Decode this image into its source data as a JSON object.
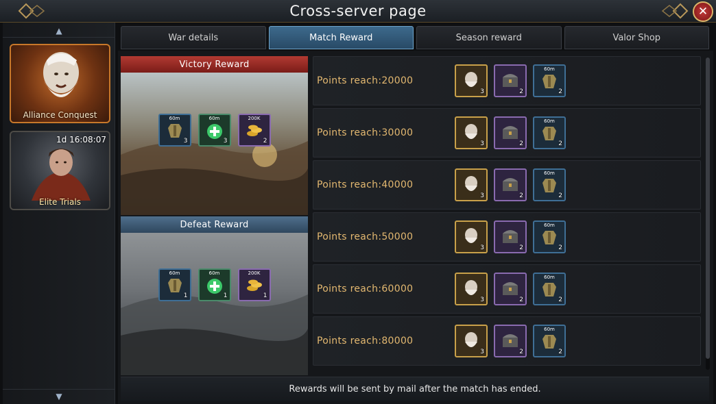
{
  "window": {
    "title": "Cross-server page"
  },
  "sidebar": {
    "items": [
      {
        "label": "Alliance Conquest",
        "timer": ""
      },
      {
        "label": "Elite Trials",
        "timer": "1d 16:08:07"
      }
    ]
  },
  "tabs": [
    {
      "label": "War details"
    },
    {
      "label": "Match Reward"
    },
    {
      "label": "Season reward"
    },
    {
      "label": "Valor Shop"
    }
  ],
  "victory": {
    "header": "Victory Reward",
    "items": [
      {
        "tag": "60m",
        "count": "3",
        "icon": "armor-icon"
      },
      {
        "tag": "60m",
        "count": "3",
        "icon": "heal-potion-icon"
      },
      {
        "tag": "200K",
        "count": "2",
        "icon": "gold-coins-icon"
      }
    ]
  },
  "defeat": {
    "header": "Defeat Reward",
    "items": [
      {
        "tag": "60m",
        "count": "1",
        "icon": "armor-icon"
      },
      {
        "tag": "60m",
        "count": "1",
        "icon": "heal-potion-icon"
      },
      {
        "tag": "200K",
        "count": "1",
        "icon": "gold-coins-icon"
      }
    ]
  },
  "points_rows": [
    {
      "label": "Points reach:20000",
      "items": [
        {
          "count": "3",
          "icon": "general-portrait-icon"
        },
        {
          "count": "2",
          "icon": "treasure-chest-icon"
        },
        {
          "tag": "60m",
          "count": "2",
          "icon": "armor-icon"
        }
      ]
    },
    {
      "label": "Points reach:30000",
      "items": [
        {
          "count": "3",
          "icon": "general-portrait-icon"
        },
        {
          "count": "2",
          "icon": "treasure-chest-icon"
        },
        {
          "tag": "60m",
          "count": "2",
          "icon": "armor-icon"
        }
      ]
    },
    {
      "label": "Points reach:40000",
      "items": [
        {
          "count": "3",
          "icon": "general-portrait-icon"
        },
        {
          "count": "2",
          "icon": "treasure-chest-icon"
        },
        {
          "tag": "60m",
          "count": "2",
          "icon": "armor-icon"
        }
      ]
    },
    {
      "label": "Points reach:50000",
      "items": [
        {
          "count": "3",
          "icon": "general-portrait-icon"
        },
        {
          "count": "2",
          "icon": "treasure-chest-icon"
        },
        {
          "tag": "60m",
          "count": "2",
          "icon": "armor-icon"
        }
      ]
    },
    {
      "label": "Points reach:60000",
      "items": [
        {
          "count": "3",
          "icon": "general-portrait-icon"
        },
        {
          "count": "2",
          "icon": "treasure-chest-icon"
        },
        {
          "tag": "60m",
          "count": "2",
          "icon": "armor-icon"
        }
      ]
    },
    {
      "label": "Points reach:80000",
      "items": [
        {
          "count": "3",
          "icon": "general-portrait-icon"
        },
        {
          "count": "2",
          "icon": "treasure-chest-icon"
        },
        {
          "tag": "60m",
          "count": "2",
          "icon": "armor-icon"
        }
      ]
    }
  ],
  "footer": {
    "note": "Rewards will be sent by mail after the match has ended."
  },
  "colors": {
    "accent_tab": "#3d6a8c",
    "victory_red": "#b23a32",
    "defeat_blue": "#4f6f8c",
    "points_text": "#e3b870"
  }
}
